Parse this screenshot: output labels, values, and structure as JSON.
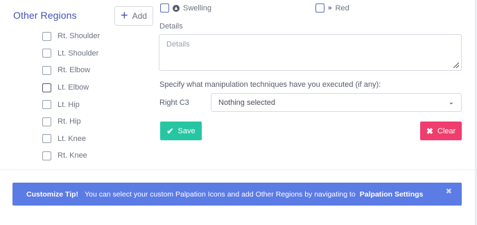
{
  "regions": {
    "title": "Other Regions",
    "add_label": "Add",
    "items": [
      {
        "label": "Rt. Shoulder"
      },
      {
        "label": "Lt. Shoulder"
      },
      {
        "label": "Rt. Elbow"
      },
      {
        "label": "Lt. Elbow"
      },
      {
        "label": "Lt. Hip"
      },
      {
        "label": "Rt. Hip"
      },
      {
        "label": "Lt. Knee"
      },
      {
        "label": "Rt. Knee"
      }
    ]
  },
  "findings": {
    "swelling_label": "Swelling",
    "red_label": "Red"
  },
  "details": {
    "label": "Details",
    "placeholder": "Details"
  },
  "manipulation": {
    "question": "Specify what manipulation techniques have you executed (if any):",
    "row_label": "Right C3",
    "select_value": "Nothing selected"
  },
  "actions": {
    "save_label": "Save",
    "clear_label": "Clear"
  },
  "tip": {
    "heading": "Customize Tip!",
    "text": "You can select your custom Palpation Icons and add Other Regions by navigating to",
    "link": "Palpation Settings",
    "close": "✖"
  },
  "colors": {
    "accent": "#3f51b5",
    "save": "#26c6a2",
    "clear": "#ef3e6d",
    "tip_bg": "#5b7be5"
  }
}
